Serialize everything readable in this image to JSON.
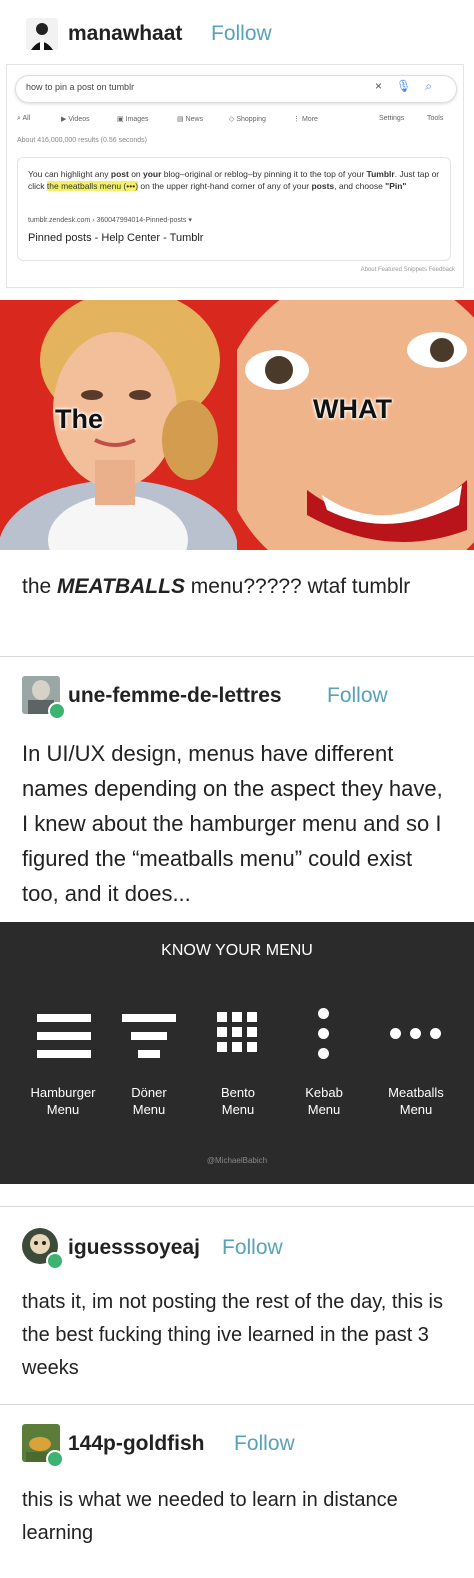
{
  "post1": {
    "username": "manawhaat",
    "follow": "Follow",
    "google": {
      "query": "how to pin a post on tumblr",
      "tabs": [
        "All",
        "Videos",
        "Images",
        "News",
        "Shopping",
        "More",
        "Settings",
        "Tools"
      ],
      "result_count": "About 416,000,000 results (0.56 seconds)",
      "snippet_before": "You can highlight any ",
      "snippet_post": "post",
      "snippet_mid1": " on ",
      "snippet_your": "your",
      "snippet_mid2": " blog–original or reblog–by pinning it to the top of your ",
      "snippet_tumblr": "Tumblr",
      "snippet_mid3": ". Just tap or click ",
      "snippet_highlight": "the meatballs menu (•••)",
      "snippet_mid4": " on the upper right-hand corner of any of your ",
      "snippet_posts": "posts",
      "snippet_mid5": ", and choose ",
      "snippet_pin": "\"Pin\"",
      "url": "tumblr.zendesk.com › 360047994014-Pinned-posts ▾",
      "title": "Pinned posts - Help Center - Tumblr",
      "footer": "About Featured Snippets   Feedback"
    },
    "meme": {
      "left_caption": "The",
      "right_caption": "WHAT",
      "colors": {
        "red": "#d9281e",
        "skin": "#f0b48a"
      }
    },
    "text_prefix": "the ",
    "text_bold": "MEATBALLS",
    "text_suffix": " menu????? wtaf tumblr"
  },
  "post2": {
    "username": "une-femme-de-lettres",
    "follow": "Follow",
    "text": "In UI/UX design, menus have different names depending on the aspect they have, I knew about the hamburger menu and so I figured the “meatballs menu” could exist too, and it does...",
    "kym": {
      "title": "KNOW  YOUR MENU",
      "menus": [
        {
          "name": "Hamburger",
          "sub": "Menu"
        },
        {
          "name": "Döner",
          "sub": "Menu"
        },
        {
          "name": "Bento",
          "sub": "Menu"
        },
        {
          "name": "Kebab",
          "sub": "Menu"
        },
        {
          "name": "Meatballs",
          "sub": "Menu"
        }
      ],
      "credit": "@MichaelBabich"
    }
  },
  "post3": {
    "username": "iguesssoyeaj",
    "follow": "Follow",
    "text": "thats it, im not posting the rest of the day, this is the best fucking thing ive learned in the past 3 weeks"
  },
  "post4": {
    "username": "144p-goldfish",
    "follow": "Follow",
    "text": "this is what we needed to learn in distance learning"
  },
  "colors": {
    "follow": "#57a2b8",
    "reblog": "#3cb371",
    "kym_bg": "#2b2b2b",
    "highlight": "#f4f168"
  }
}
